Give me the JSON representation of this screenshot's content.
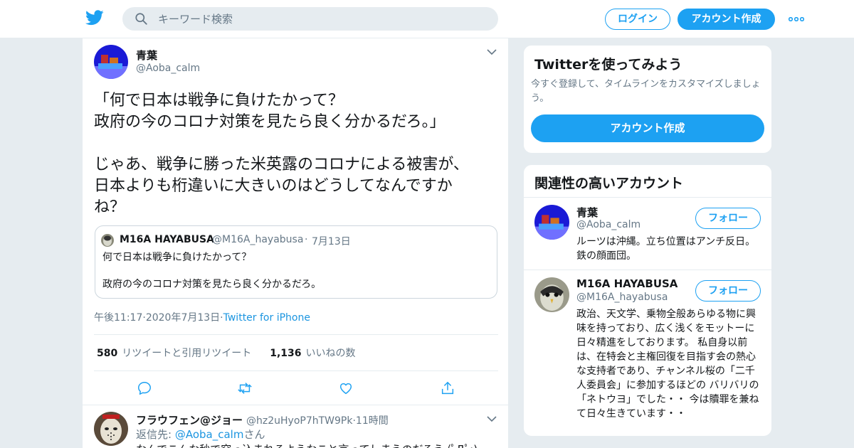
{
  "header": {
    "search_placeholder": "キーワード検索",
    "login_label": "ログイン",
    "signup_label": "アカウント作成"
  },
  "tweet": {
    "author_name": "青葉",
    "author_handle": "@Aoba_calm",
    "text": "「何で日本は戦争に負けたかって？\n政府の今のコロナ対策を見たら良く分かるだろ。」\n\nじゃあ、戦争に勝った米英露のコロナによる被害が、\n日本よりも桁違いに大きいのはどうしてなんですか\nね？",
    "quote": {
      "name": "M16A HAYABUSA",
      "handle": "@M16A_hayabusa",
      "separator": "·",
      "date": "7月13日",
      "text": "何で日本は戦争に負けたかって？\n\n政府の今のコロナ対策を見たら良く分かるだろ。"
    },
    "time": "午後11:17",
    "date": "2020年7月13日",
    "dot": "·",
    "source": "Twitter for iPhone",
    "retweet_count": "580",
    "retweet_label": "リツイートと引用リツイート",
    "like_count": "1,136",
    "like_label": "いいねの数"
  },
  "reply": {
    "name": "フラウフェン@ジョー",
    "handle": "@hz2uHyoP7hTW9Pk",
    "separator": "·",
    "time": "11時間",
    "reply_to_label": "返信先:",
    "reply_to_handle": "@Aoba_calm",
    "reply_to_suffix": "さん",
    "text": "なんでこんな秒で突っ込まれるようなこと言ってしまうのだろう (ﾟДﾟ;)"
  },
  "sidebar": {
    "signup_card": {
      "title": "Twitterを使ってみよう",
      "subtitle": "今すぐ登録して、タイムラインをカスタマイズしましょう。",
      "button_label": "アカウント作成"
    },
    "related": {
      "title": "関連性の高いアカウント",
      "follow_label": "フォロー",
      "accounts": [
        {
          "name": "青葉",
          "handle": "@Aoba_calm",
          "bio": "ルーツは沖縄。立ち位置はアンチ反日。鉄の顔面団。"
        },
        {
          "name": "M16A HAYABUSA",
          "handle": "@M16A_hayabusa",
          "bio": "政治、天文学、乗物全般あらゆる物に興味を持っており、広く浅くをモットーに日々精進をしております。 私自身以前は、在特会と主権回復を目指す会の熱心な支持者であり、チャンネル桜の「二千人委員会」に参加するほどの バリバリの「ネトウヨ」でした・・ 今は贖罪を兼ねて日々生きています・・"
        }
      ]
    }
  },
  "colors": {
    "accent": "#1da1f2",
    "link": "#1b95e0",
    "secondary_text": "#657786",
    "background": "#e6ecf0"
  },
  "icons": [
    "twitter-bird-icon",
    "search-icon",
    "more-dots-icon",
    "chevron-down-icon",
    "reply-icon",
    "retweet-icon",
    "like-icon",
    "share-icon"
  ]
}
